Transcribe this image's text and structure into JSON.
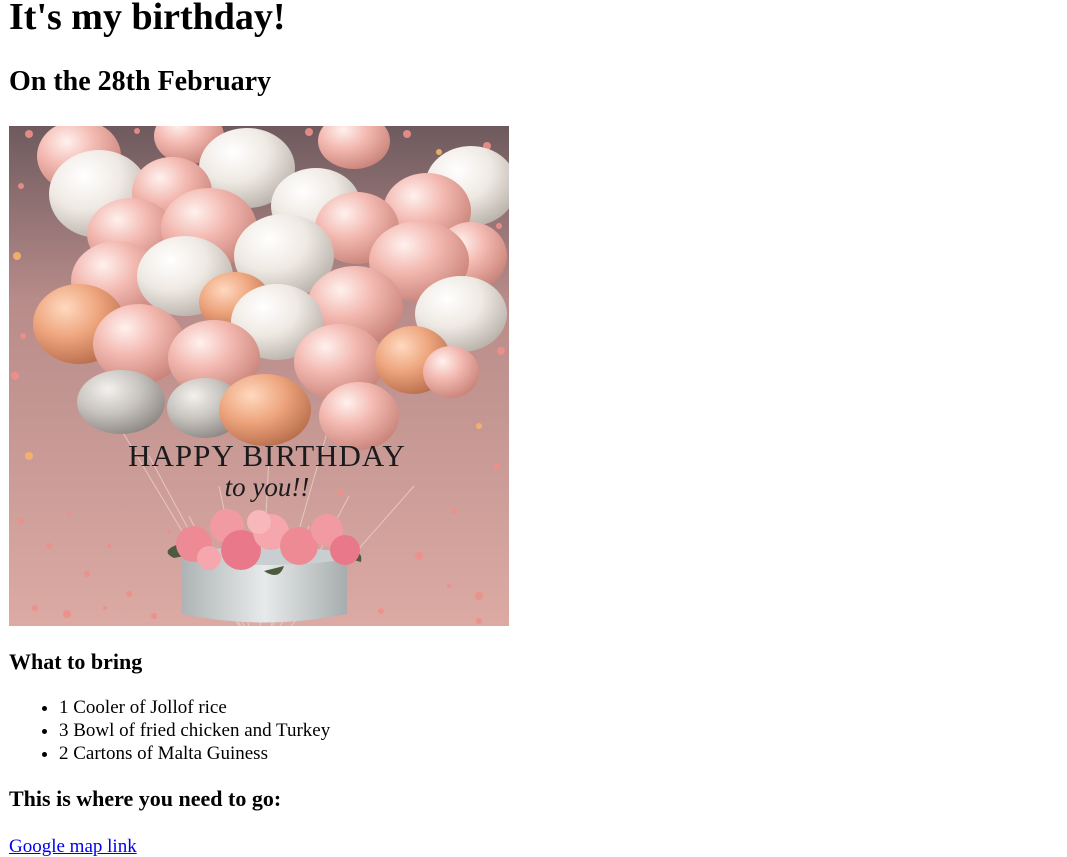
{
  "page": {
    "title": "It's my birthday!",
    "subtitle": "On the 28th February"
  },
  "hero_image": {
    "alt": "Happy birthday balloons",
    "text_line1": "HAPPY BIRTHDAY",
    "text_line2": "to you!!",
    "colors": {
      "background_top": "#6e5a5e",
      "background_bottom": "#d9a59f",
      "balloon_pink": "#f3b9b1",
      "balloon_white": "#f2ece6",
      "balloon_peach": "#eda47c",
      "pot": "#d8dcdc",
      "flowers": "#ee8a93"
    }
  },
  "bring": {
    "heading": "What to bring",
    "items": [
      "1 Cooler of Jollof rice",
      "3 Bowl of fried chicken and Turkey",
      "2 Cartons of Malta Guiness"
    ]
  },
  "location": {
    "heading": "This is where you need to go:",
    "link_label": "Google map link"
  }
}
